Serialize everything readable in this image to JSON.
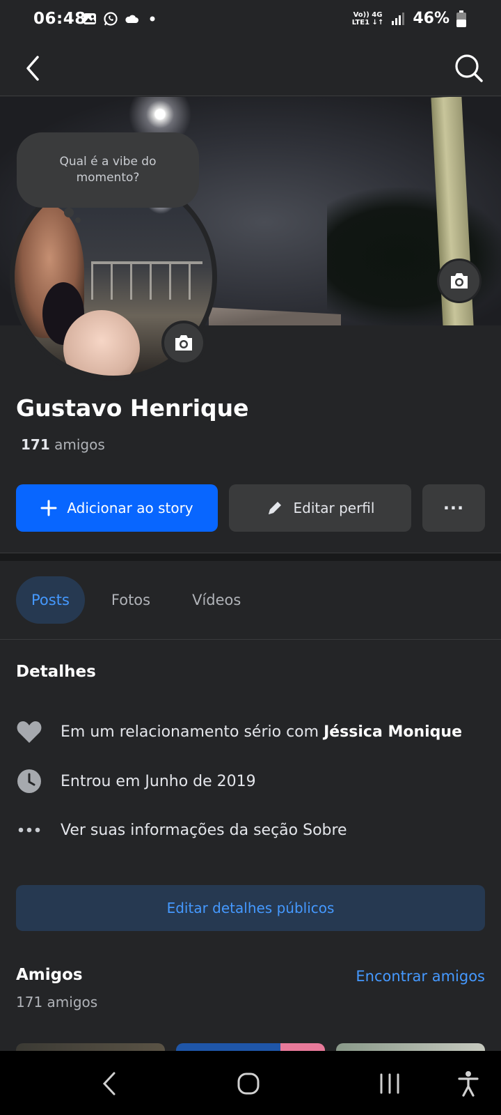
{
  "status_bar": {
    "time": "06:48",
    "network_top": "Vo)) 4G",
    "network_bottom": "LTE1 ↓↑",
    "battery": "46%"
  },
  "app_bar": {
    "back_icon": "back-arrow-icon",
    "search_icon": "search-icon"
  },
  "profile": {
    "bubble_text": "Qual é a vibe do momento?",
    "name": "Gustavo Henrique",
    "friends_number": "171",
    "friends_label": " amigos"
  },
  "actions": {
    "add_story": "Adicionar ao story",
    "edit_profile": "Editar perfil",
    "more": "···"
  },
  "tabs": [
    "Posts",
    "Fotos",
    "Vídeos"
  ],
  "details": {
    "title": "Detalhes",
    "relationship_prefix": "Em um relacionamento sério com ",
    "relationship_partner": "Jéssica Monique",
    "joined": "Entrou em Junho de 2019",
    "about": "Ver suas informações da seção Sobre",
    "edit_public": "Editar detalhes públicos"
  },
  "friends": {
    "title": "Amigos",
    "find": "Encontrar amigos",
    "count": "171 amigos"
  },
  "colors": {
    "background": "#242527",
    "primary_blue": "#0866ff",
    "link_blue": "#4599ff",
    "secondary_button": "#3a3b3c"
  }
}
